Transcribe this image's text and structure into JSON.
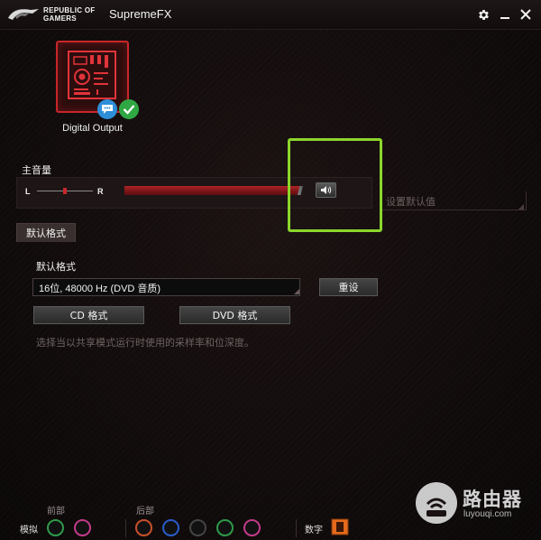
{
  "window": {
    "brand_line1": "REPUBLIC OF",
    "brand_line2": "GAMERS",
    "title": "SupremeFX",
    "icons": [
      "settings-gear-icon",
      "minimize-icon",
      "close-icon"
    ]
  },
  "device": {
    "label": "Digital Output",
    "icon": "motherboard-chip-icon",
    "badges": [
      "chat-bubble-icon",
      "check-icon"
    ],
    "accent": "#c8262a"
  },
  "volume": {
    "title": "主音量",
    "left_label": "L",
    "right_label": "R",
    "mute_icon": "speaker-icon",
    "set_default_text": "设置默认值",
    "highlight_color": "#8cd62c"
  },
  "tabs": [
    {
      "label": "默认格式"
    }
  ],
  "default_format": {
    "title": "默认格式",
    "selected": "16位, 48000 Hz (DVD 音质)",
    "reset_label": "重设",
    "cd_label": "CD 格式",
    "dvd_label": "DVD 格式",
    "hint": "选择当以共享模式运行时使用的采样率和位深度。"
  },
  "jacks": {
    "front_label": "前部",
    "back_label": "后部",
    "analog_label": "模拟",
    "digital_label": "数字",
    "front_colors": [
      "#2e9a4a",
      "#c23a8a"
    ],
    "back_colors": [
      "#c8502a",
      "#2a5cc8",
      "#444444",
      "#2e9a4a",
      "#c23a8a"
    ]
  },
  "watermark": {
    "text": "路由器",
    "sub": "luyouqi.com"
  }
}
